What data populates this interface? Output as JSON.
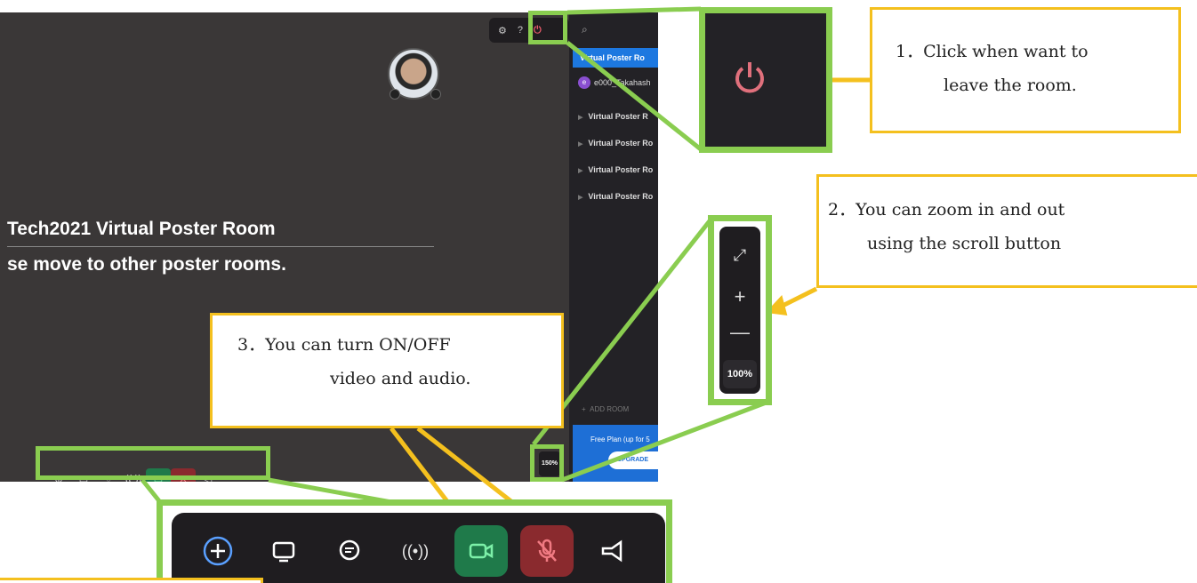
{
  "app": {
    "room_title": "Tech2021 Virtual Poster Room",
    "room_subtitle": "se move to other poster rooms.",
    "zoom_level_small": "150%"
  },
  "topbar": {
    "icons": [
      "gear-icon",
      "help-icon",
      "power-icon"
    ],
    "search_icon": "search-icon"
  },
  "sidebar": {
    "active_room": "Virtual Poster Ro",
    "user": "e000_Takahash",
    "rooms": [
      "Virtual Poster R",
      "Virtual Poster Ro",
      "Virtual Poster Ro",
      "Virtual Poster Ro"
    ],
    "add_room": "ADD ROOM",
    "free_plan": "Free Plan (up for 5",
    "upgrade": "UPGRADE"
  },
  "zoom_panel": {
    "level": "100%",
    "buttons": [
      "expand-icon",
      "plus-icon",
      "minus-icon"
    ]
  },
  "toolbar": {
    "items": [
      "add-icon",
      "screen-share-icon",
      "chat-icon",
      "broadcast-icon",
      "camera-icon",
      "mic-muted-icon",
      "megaphone-icon"
    ]
  },
  "callouts": {
    "c1_line1": "1．Click when want to",
    "c1_line2": "leave the room.",
    "c2_line1": "2．You can zoom in and out",
    "c2_line2": "using the scroll button",
    "c3_line1": "3．You can turn ON/OFF",
    "c3_line2": "video and audio."
  },
  "colors": {
    "highlight": "#8acd50",
    "callout_border": "#f4c01e",
    "active_blue": "#1d78e0",
    "camera_green": "#1f7a4a",
    "mic_red": "#8a2a2e"
  }
}
